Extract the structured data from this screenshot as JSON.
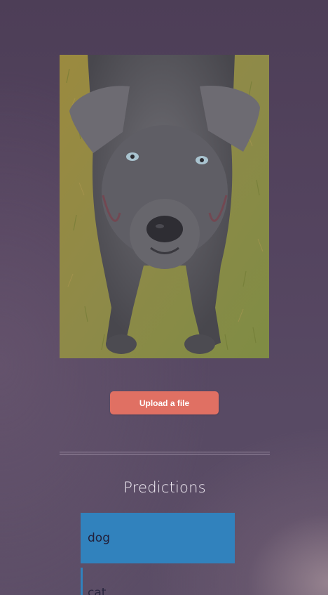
{
  "image": {
    "subject_icon": "dog-photo"
  },
  "upload": {
    "button_label": "Upload a file"
  },
  "predictions": {
    "title": "Predictions",
    "items": [
      {
        "label": "dog"
      },
      {
        "label": "cat"
      }
    ]
  },
  "colors": {
    "button": "#e07063",
    "bar": "#3182bd",
    "background": "#54445f"
  }
}
